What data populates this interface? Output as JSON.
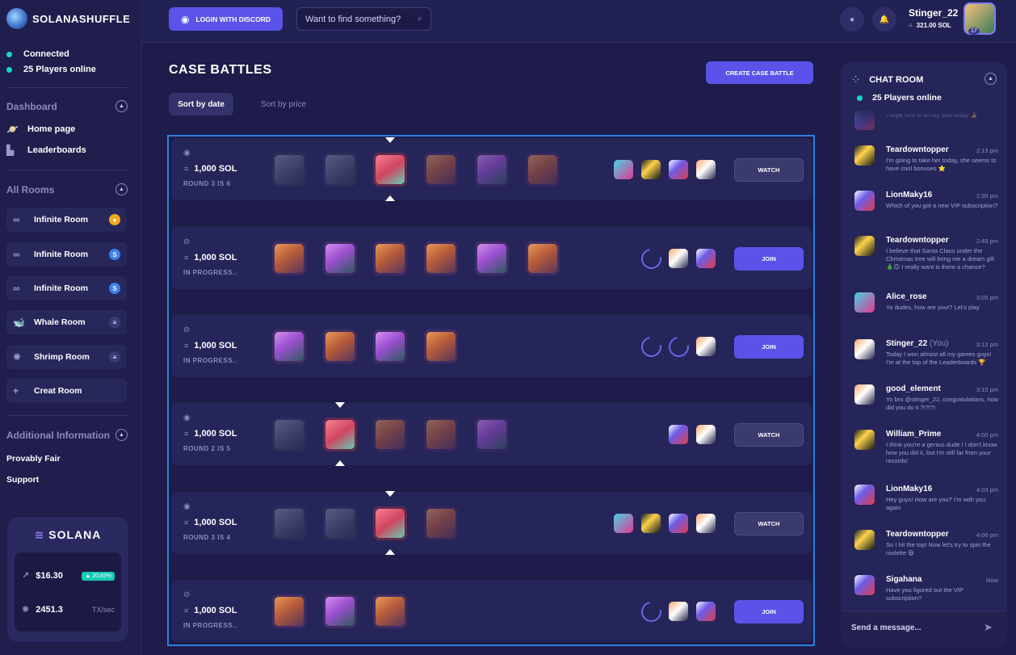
{
  "brand": {
    "name": "SOLANASHUFFLE"
  },
  "sidebar": {
    "status": {
      "connected": "Connected",
      "players": "25 Players online"
    },
    "dashboard": {
      "title": "Dashboard",
      "items": [
        {
          "label": "Home page",
          "icon": "planet-icon"
        },
        {
          "label": "Leaderboards",
          "icon": "podium-icon"
        }
      ]
    },
    "rooms": {
      "title": "All Rooms",
      "items": [
        {
          "label": "Infinite Room",
          "icon": "infinity-icon",
          "badge_color": "#f0a820"
        },
        {
          "label": "Infinite Room",
          "icon": "infinity-icon",
          "badge_color": "#3a7ef0"
        },
        {
          "label": "Infinite Room",
          "icon": "infinity-icon",
          "badge_color": "#3a7ef0"
        },
        {
          "label": "Whale Room",
          "icon": "whale-icon",
          "badge_color": "#3a3a78"
        },
        {
          "label": "Shrimp Room",
          "icon": "shrimp-icon",
          "badge_color": "#3a3a78"
        },
        {
          "label": "Creat Room",
          "icon": "plus-icon"
        }
      ]
    },
    "additional": {
      "title": "Additional Information",
      "items": [
        "Provably Fair",
        "Support"
      ]
    },
    "solana": {
      "title": "SOLANA",
      "price": "$16.30",
      "change": "▲ 20,83%",
      "tps": "2451.3",
      "tps_unit": "TX/sec"
    }
  },
  "topbar": {
    "discord_label": "LOGIN WITH DISCORD",
    "search_placeholder": "Want to find something?",
    "user": {
      "name": "Stinger_22",
      "balance": "321.00 SOL",
      "level": "17"
    }
  },
  "main": {
    "title": "CASE BATTLES",
    "create_label": "CREATE CASE BATTLE",
    "sort": {
      "date": "Sort by date",
      "price": "Sort by price"
    },
    "battles": [
      {
        "amount": "1,000 SOL",
        "status": "ROUND 3 IS 6",
        "visible": true,
        "action": "WATCH",
        "cases": [
          "grey",
          "grey",
          "open",
          "orange",
          "purple",
          "orange"
        ],
        "active_case": 2,
        "players": [
          "pa1",
          "pa2",
          "pa3",
          "pa4"
        ],
        "waiting": 0
      },
      {
        "amount": "1,000 SOL",
        "status": "IN PROGRESS..",
        "visible": false,
        "action": "JOIN",
        "cases": [
          "orange",
          "purple",
          "orange",
          "orange",
          "purple",
          "orange"
        ],
        "active_case": -1,
        "players": [
          "pa4",
          "pa3"
        ],
        "waiting": 1
      },
      {
        "amount": "1,000 SOL",
        "status": "IN PROGRESS..",
        "visible": false,
        "action": "JOIN",
        "cases": [
          "purple",
          "orange",
          "purple",
          "orange"
        ],
        "active_case": -1,
        "players": [
          "pa4"
        ],
        "waiting": 2
      },
      {
        "amount": "1,000 SOL",
        "status": "ROUND 2 IS 5",
        "visible": true,
        "action": "WATCH",
        "cases": [
          "grey",
          "open",
          "orange",
          "orange",
          "purple"
        ],
        "active_case": 1,
        "players": [
          "pa3",
          "pa4"
        ],
        "waiting": 0
      },
      {
        "amount": "1,000 SOL",
        "status": "ROUND 3 IS 4",
        "visible": true,
        "action": "WATCH",
        "cases": [
          "grey",
          "grey",
          "open",
          "orange"
        ],
        "active_case": 2,
        "players": [
          "pa1",
          "pa2",
          "pa3",
          "pa4"
        ],
        "waiting": 0
      },
      {
        "amount": "1,000 SOL",
        "status": "IN PROGRESS..",
        "visible": false,
        "action": "JOIN",
        "cases": [
          "orange",
          "purple",
          "orange"
        ],
        "active_case": -1,
        "players": [
          "pa4",
          "pa3"
        ],
        "waiting": 1
      }
    ]
  },
  "chat": {
    "title": "CHAT ROOM",
    "online": "25 Players online",
    "input_placeholder": "Send a message...",
    "messages": [
      {
        "name": "",
        "you": "",
        "time": "",
        "text": "I hope luck is on my side today 🙏",
        "avatar": "pa3"
      },
      {
        "name": "Teardowntopper",
        "you": "",
        "time": "2:13 pm",
        "text": "I'm going to take her today, she seems to have cool bonuses ⭐",
        "avatar": "pa2"
      },
      {
        "name": "LionMaky16",
        "you": "",
        "time": "2:30 pm",
        "text": "Which of you got a new VIP subscription?",
        "avatar": "pa3"
      },
      {
        "name": "Teardowntopper",
        "you": "",
        "time": "2:45 pm",
        "text": "I believe that Santa Claus under the Christmas tree will bring me a dream gift 🎄😊 I really want is there a chance?",
        "avatar": "pa2"
      },
      {
        "name": "Alice_rose",
        "you": "",
        "time": "3:05 pm",
        "text": "Yo dudes, how are you!? Let's play",
        "avatar": "pa1"
      },
      {
        "name": "Stinger_22",
        "you": "(You)",
        "time": "3:12 pm",
        "text": "Today I won almost all my games guys! I'm at the top of the Leaderboards 🏆",
        "avatar": "pa4"
      },
      {
        "name": "good_element",
        "you": "",
        "time": "3:15 pm",
        "text": "Yo bro @stinger_22, congratulations, how did you do it ?!?!?!",
        "avatar": "pa4"
      },
      {
        "name": "William_Prime",
        "you": "",
        "time": "4:00 pm",
        "text": "I think you're a genius dude ! I don't know how you did it, but I'm still far from your records!",
        "avatar": "pa2"
      },
      {
        "name": "LionMaky16",
        "you": "",
        "time": "4:03 pm",
        "text": "Hey guys! How are you? I'm with you again",
        "avatar": "pa3"
      },
      {
        "name": "Teardowntopper",
        "you": "",
        "time": "4:06 pm",
        "text": "So I hit the top! Now let's try to spin the roulette 😄",
        "avatar": "pa2"
      },
      {
        "name": "Sigahana",
        "you": "",
        "time": "Now",
        "text": "Have you figured out the VIP subscription?",
        "avatar": "pa3"
      }
    ]
  }
}
